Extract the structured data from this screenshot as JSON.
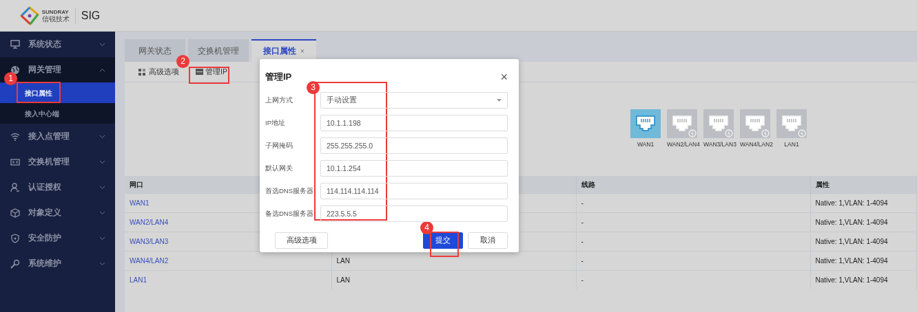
{
  "header": {
    "brand_en": "SUNDRAY",
    "brand_cn": "信锐技术",
    "product": "SIG"
  },
  "sidebar": {
    "items": [
      {
        "label": "系统状态",
        "expanded": false
      },
      {
        "label": "网关管理",
        "expanded": true,
        "children": [
          {
            "label": "接口属性",
            "selected": true
          },
          {
            "label": "接入中心端",
            "selected": false
          }
        ]
      },
      {
        "label": "接入点管理",
        "expanded": false
      },
      {
        "label": "交换机管理",
        "expanded": false
      },
      {
        "label": "认证授权",
        "expanded": false
      },
      {
        "label": "对象定义",
        "expanded": false
      },
      {
        "label": "安全防护",
        "expanded": false
      },
      {
        "label": "系统维护",
        "expanded": false
      }
    ]
  },
  "tabs": [
    {
      "label": "网关状态",
      "selected": false
    },
    {
      "label": "交换机管理",
      "selected": false
    },
    {
      "label": "接口属性",
      "selected": true,
      "close": "×"
    }
  ],
  "toolbar": [
    "高级选项",
    "管理IP"
  ],
  "ports": [
    {
      "label": "WAN1",
      "selected": true
    },
    {
      "label": "WAN2/LAN4",
      "selected": false
    },
    {
      "label": "WAN3/LAN3",
      "selected": false
    },
    {
      "label": "WAN4/LAN2",
      "selected": false
    },
    {
      "label": "LAN1",
      "selected": false
    }
  ],
  "table": {
    "columns": [
      "网口",
      "线路",
      "属性"
    ],
    "rows": [
      {
        "port": "WAN1",
        "line": "-",
        "attr": "Native: 1,VLAN: 1-4094"
      },
      {
        "port": "WAN2/LAN4",
        "line": "-",
        "attr": "Native: 1,VLAN: 1-4094"
      },
      {
        "port": "WAN3/LAN3",
        "line": "-",
        "attr": "Native: 1,VLAN: 1-4094"
      },
      {
        "port": "WAN4/LAN2",
        "column_2": "LAN",
        "line": "-",
        "attr": "Native: 1,VLAN: 1-4094"
      },
      {
        "port": "LAN1",
        "column_2": "LAN",
        "line": "-",
        "attr": "Native: 1,VLAN: 1-4094"
      }
    ]
  },
  "dialog": {
    "title": "管理IP",
    "close": "×",
    "fields": [
      {
        "kind": "select",
        "label": "上网方式",
        "value": "手动设置"
      },
      {
        "kind": "input",
        "label": "IP地址",
        "value": "10.1.1.198"
      },
      {
        "kind": "input",
        "label": "子网掩码",
        "value": "255.255.255.0"
      },
      {
        "kind": "input",
        "label": "默认网关",
        "value": "10.1.1.254"
      },
      {
        "kind": "input",
        "label": "首选DNS服务器",
        "value": "114.114.114.114"
      },
      {
        "kind": "input",
        "label": "备选DNS服务器",
        "value": "223.5.5.5"
      }
    ],
    "buttons": [
      {
        "kind": "secondary",
        "label": "高级选项"
      },
      {
        "kind": "primary",
        "label": "提交"
      },
      {
        "kind": "secondary",
        "label": "取消"
      }
    ]
  },
  "annotations": [
    "1",
    "2",
    "3",
    "4"
  ]
}
